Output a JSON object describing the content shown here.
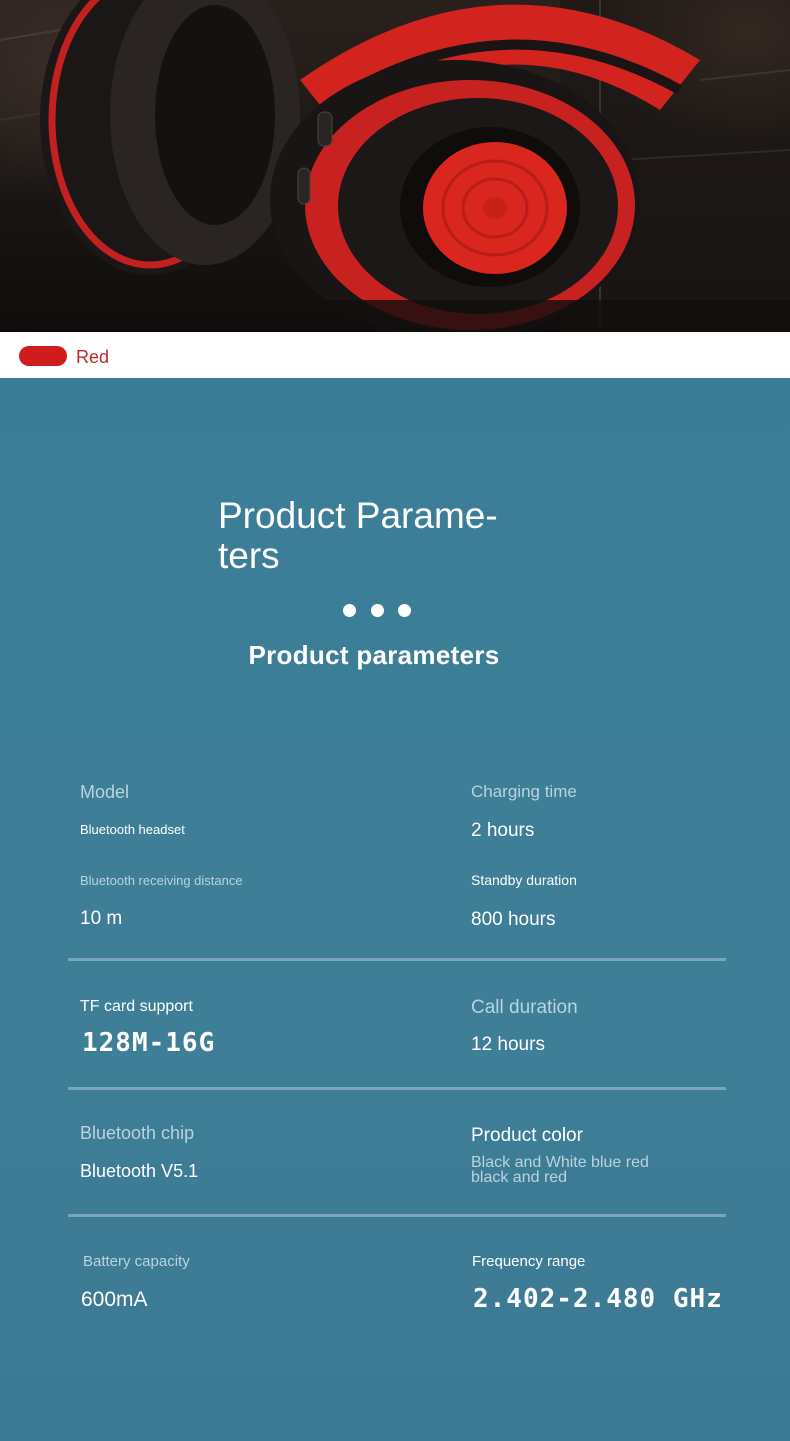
{
  "color_option": {
    "swatch_color": "#d01c1c",
    "label": "Red"
  },
  "header": {
    "title": "Product Parame-\nters",
    "subtitle": "Product parameters"
  },
  "params": {
    "model_label": "Model",
    "model_value": "Bluetooth headset",
    "charging_label": "Charging time",
    "charging_value": "2 hours",
    "distance_label": "Bluetooth receiving distance",
    "distance_value": "10 m",
    "standby_label": "Standby duration",
    "standby_value": "800 hours",
    "tf_label": "TF card support",
    "tf_value": "128M-16G",
    "call_label": "Call duration",
    "call_value": "12 hours",
    "chip_label": "Bluetooth chip",
    "chip_value": "Bluetooth V5.1",
    "color_label": "Product color",
    "color_value_line1": "Black and White blue red",
    "color_value_line2": "black and red",
    "battery_label": "Battery capacity",
    "battery_value": "600mA",
    "freq_label": "Frequency range",
    "freq_value": "2.402-2.480 GHz"
  },
  "colors": {
    "panel": "#3f7f98",
    "accent_red": "#d01c1c"
  }
}
